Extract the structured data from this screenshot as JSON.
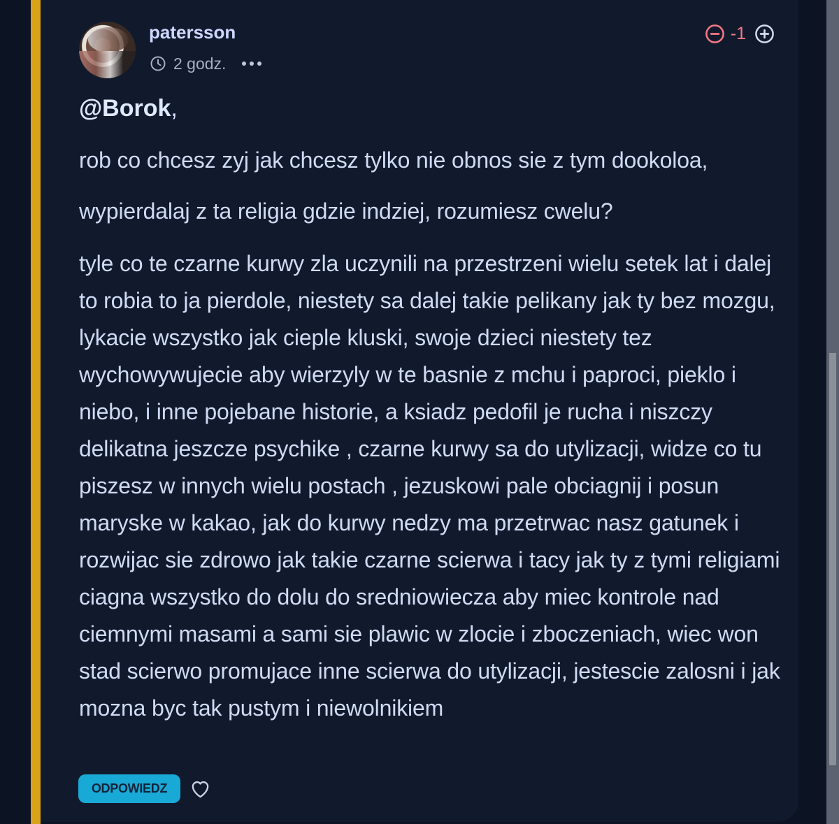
{
  "post": {
    "username": "patersson",
    "time": "2 godz.",
    "score": "-1",
    "mention": "@Borok",
    "mention_suffix": ",",
    "paragraphs": [
      "rob co chcesz zyj jak chcesz tylko nie obnos sie z tym dookoloa,",
      "wypierdalaj z ta religia gdzie indziej, rozumiesz cwelu?",
      "tyle co te czarne kurwy zla uczynili na przestrzeni wielu setek lat i dalej to robia to ja pierdole, niestety sa dalej takie pelikany jak ty bez mozgu, lykacie wszystko jak cieple kluski, swoje dzieci niestety tez wychowywujecie aby wierzyly w te basnie z mchu i paproci, pieklo i niebo, i inne pojebane historie, a ksiadz pedofil je rucha i niszczy delikatna jeszcze psychike , czarne kurwy sa do utylizacji, widze co tu piszesz w innych wielu postach , jezuskowi pale obciagnij i posun maryske w kakao, jak do kurwy nedzy ma przetrwac nasz gatunek i rozwijac sie zdrowo jak takie czarne scierwa i tacy jak ty z tymi religiami ciagna wszystko do dolu do sredniowiecza aby miec kontrole nad ciemnymi masami a sami sie plawic w zlocie i zboczeniach, wiec won stad scierwo promujace inne scierwa do utylizacji, jestescie zalosni i jak mozna byc tak pustym i niewolnikiem"
    ],
    "actions": {
      "reply": "ODPOWIEDZ"
    }
  },
  "icons": {
    "clock": "clock-icon",
    "more": "more-options-icon",
    "downvote": "minus-circle-icon",
    "upvote": "plus-circle-icon",
    "like": "heart-icon"
  },
  "colors": {
    "background": "#0c1322",
    "card": "#111a2d",
    "accent": "#d8a21b",
    "text": "#d0daf3",
    "score": "#f47a85",
    "reply_button": "#19a9d6"
  }
}
